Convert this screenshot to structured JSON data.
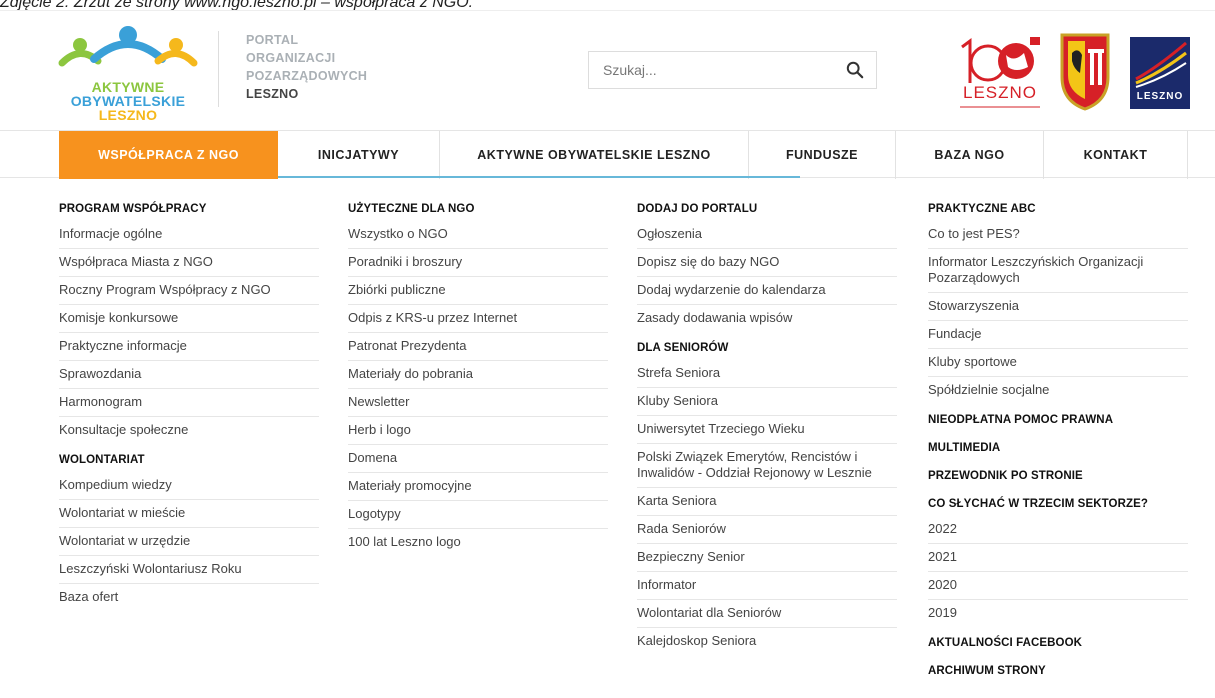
{
  "caption": "Zdjęcie 2. Zrzut ze strony www.ngo.leszno.pl – współpraca z NGO.",
  "logo": {
    "line1": "AKTYWNE",
    "line2": "OBYWATELSKIE",
    "line3": "LESZNO"
  },
  "portal": {
    "line1": "PORTAL",
    "line2": "ORGANIZACJI",
    "line3": "POZARZĄDOWYCH",
    "line4": "LESZNO"
  },
  "search": {
    "placeholder": "Szukaj..."
  },
  "logo100": {
    "text": "LESZNO"
  },
  "logo_rozwin": {
    "text": "LESZNO"
  },
  "nav": {
    "items": [
      "WSPÓŁPRACA Z NGO",
      "INICJATYWY",
      "AKTYWNE OBYWATELSKIE LESZNO",
      "FUNDUSZE",
      "BAZA NGO",
      "KONTAKT"
    ]
  },
  "columns": {
    "col1": {
      "title1": "PROGRAM WSPÓŁPRACY",
      "links1": [
        "Informacje ogólne",
        "Współpraca Miasta z NGO",
        "Roczny Program Współpracy z NGO",
        "Komisje konkursowe",
        "Praktyczne informacje",
        "Sprawozdania",
        "Harmonogram",
        "Konsultacje społeczne"
      ],
      "title2": "WOLONTARIAT",
      "links2": [
        "Kompedium wiedzy",
        "Wolontariat w mieście",
        "Wolontariat w urzędzie",
        "Leszczyński Wolontariusz Roku",
        "Baza ofert"
      ]
    },
    "col2": {
      "title1": "UŻYTECZNE DLA NGO",
      "links1": [
        "Wszystko o NGO",
        "Poradniki i broszury",
        "Zbiórki publiczne",
        "Odpis z KRS-u przez Internet",
        "Patronat Prezydenta",
        "Materiały do pobrania",
        "Newsletter",
        "Herb i logo",
        "Domena",
        "Materiały promocyjne",
        "Logotypy",
        "100 lat Leszno logo"
      ]
    },
    "col3": {
      "title1": "DODAJ DO PORTALU",
      "links1": [
        "Ogłoszenia",
        "Dopisz się do bazy NGO",
        "Dodaj wydarzenie do kalendarza",
        "Zasady dodawania wpisów"
      ],
      "title2": "DLA SENIORÓW",
      "links2": [
        "Strefa Seniora",
        "Kluby Seniora",
        "Uniwersytet Trzeciego Wieku",
        "Polski Związek Emerytów, Rencistów i Inwalidów - Oddział Rejonowy w Lesznie",
        "Karta Seniora",
        "Rada Seniorów",
        "Bezpieczny Senior",
        "Informator",
        "Wolontariat dla Seniorów",
        "Kalejdoskop Seniora"
      ]
    },
    "col4": {
      "title1": "PRAKTYCZNE ABC",
      "links1": [
        "Co to jest PES?",
        "Informator Leszczyńskich Organizacji Pozarządowych",
        "Stowarzyszenia",
        "Fundacje",
        "Kluby sportowe",
        "Spółdzielnie socjalne"
      ],
      "title2": "NIEODPŁATNA POMOC PRAWNA",
      "title3": "MULTIMEDIA",
      "title4": "PRZEWODNIK PO STRONIE",
      "title5": "CO SŁYCHAĆ W TRZECIM SEKTORZE?",
      "links5": [
        "2022",
        "2021",
        "2020",
        "2019"
      ],
      "title6": "AKTUALNOŚCI FACEBOOK",
      "title7": "ARCHIWUM STRONY"
    }
  },
  "colors": {
    "accent_orange": "#f7921e",
    "accent_blue": "#67b8d9",
    "logo_green": "#8cc63f",
    "logo_blue": "#3aa0d8",
    "logo_yellow": "#f5b81c",
    "red": "#d62027",
    "navy": "#1b2a6b"
  }
}
